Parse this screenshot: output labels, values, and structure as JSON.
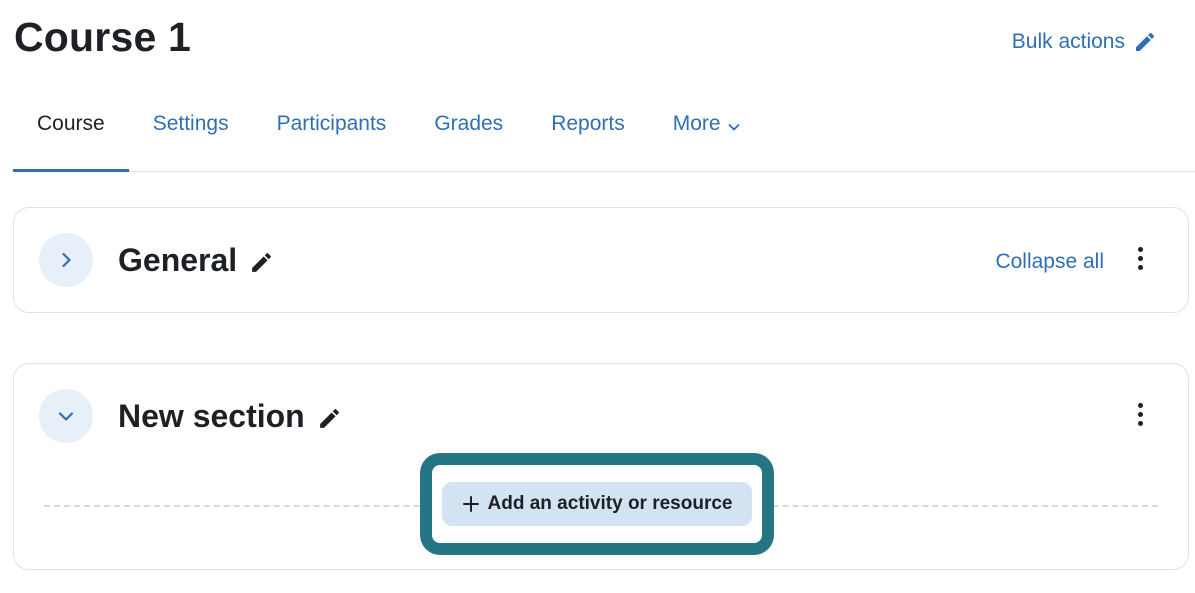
{
  "header": {
    "course_title": "Course 1",
    "bulk_actions_label": "Bulk actions"
  },
  "tabs": [
    {
      "label": "Course",
      "active": true
    },
    {
      "label": "Settings",
      "active": false
    },
    {
      "label": "Participants",
      "active": false
    },
    {
      "label": "Grades",
      "active": false
    },
    {
      "label": "Reports",
      "active": false
    },
    {
      "label": "More",
      "active": false
    }
  ],
  "sections": {
    "general": {
      "title": "General",
      "collapse_all_label": "Collapse all",
      "expanded": false
    },
    "new_section": {
      "title": "New section",
      "expanded": true,
      "add_activity_label": "Add an activity or resource"
    }
  },
  "icons": {
    "edit": "pencil-icon",
    "kebab": "kebab-menu-icon",
    "expand": "chevron-right-icon",
    "collapse": "chevron-down-icon",
    "more_dropdown": "chevron-down-icon",
    "add": "plus-icon"
  },
  "colors": {
    "link": "#2f6fb3",
    "text": "#1d2125",
    "toggle_bg": "#e7eff8",
    "add_button_bg": "#d3e3f2",
    "highlight_ring": "#257585"
  }
}
